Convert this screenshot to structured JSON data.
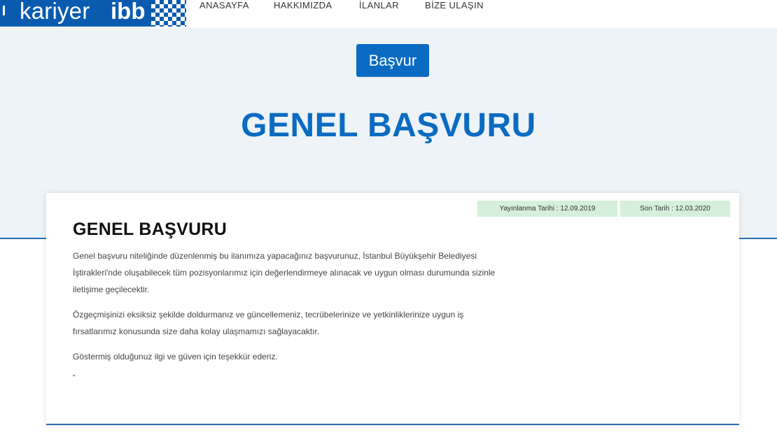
{
  "header": {
    "logo": {
      "kariyer": "kariyer",
      "ibb": "ibb"
    },
    "nav": [
      {
        "label": "ANASAYFA"
      },
      {
        "label": "HAKKIMIZDA"
      },
      {
        "label": "İLANLAR"
      },
      {
        "label": "BİZE ULAŞIN"
      }
    ]
  },
  "hero": {
    "apply_label": "Başvur",
    "title": "GENEL BAŞVURU"
  },
  "card": {
    "published_date": "Yayınlanma Tarihi : 12.09.2019",
    "end_date": "Son Tarih : 12.03.2020",
    "title": "GENEL BAŞVURU",
    "paragraphs": [
      "Genel başvuru niteliğinde düzenlenmiş bu ilanımıza yapacağınız başvurunuz, İstanbul Büyükşehir Belediyesi İştirakleri'nde oluşabilecek tüm pozisyonlarımız için değerlendirmeye alınacak ve uygun olması durumunda sizinle iletişime geçilecektir.",
      "Özgeçmişinizi eksiksiz şekilde doldurmanız ve güncellemeniz, tecrübelerinize ve yetkinliklerinize uygun iş fırsatlarımız konusunda size daha kolay ulaşmamızı sağlayacaktır.",
      "Göstermiş olduğunuz ilgi ve güven için teşekkür ederiz."
    ],
    "trailing_mark": "\""
  },
  "colors": {
    "brand_blue": "#0a6bc2",
    "hero_bg": "#eef3f7",
    "badge_bg": "#d4f0da"
  }
}
